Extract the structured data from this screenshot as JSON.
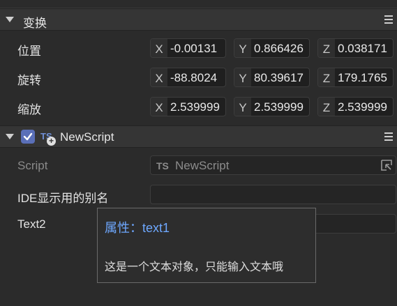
{
  "transform": {
    "title": "变换",
    "rows": [
      {
        "label": "位置",
        "x": "-0.00131",
        "y": "0.866426",
        "z": "0.038171"
      },
      {
        "label": "旋转",
        "x": "-88.8024",
        "y": "80.39617",
        "z": "179.1765"
      },
      {
        "label": "缩放",
        "x": "2.539999",
        "y": "2.539999",
        "z": "2.539999"
      }
    ],
    "axes": {
      "x": "X",
      "y": "Y",
      "z": "Z"
    }
  },
  "component": {
    "title": "NewScript",
    "icon": "ts-script-add-icon",
    "enabled": true,
    "script_label": "Script",
    "script_icon_text": "TS",
    "script_value": "NewScript",
    "ide_alias_label": "IDE显示用的别名",
    "ide_alias_value": "",
    "text2_label": "Text2",
    "text2_value": ""
  },
  "tooltip": {
    "title": "属性：text1",
    "description": "这是一个文本对象，只能输入文本哦"
  },
  "colors": {
    "accent": "#6ea8ff",
    "checkbox": "#5a6fb8",
    "panel": "#2b2b2b"
  }
}
